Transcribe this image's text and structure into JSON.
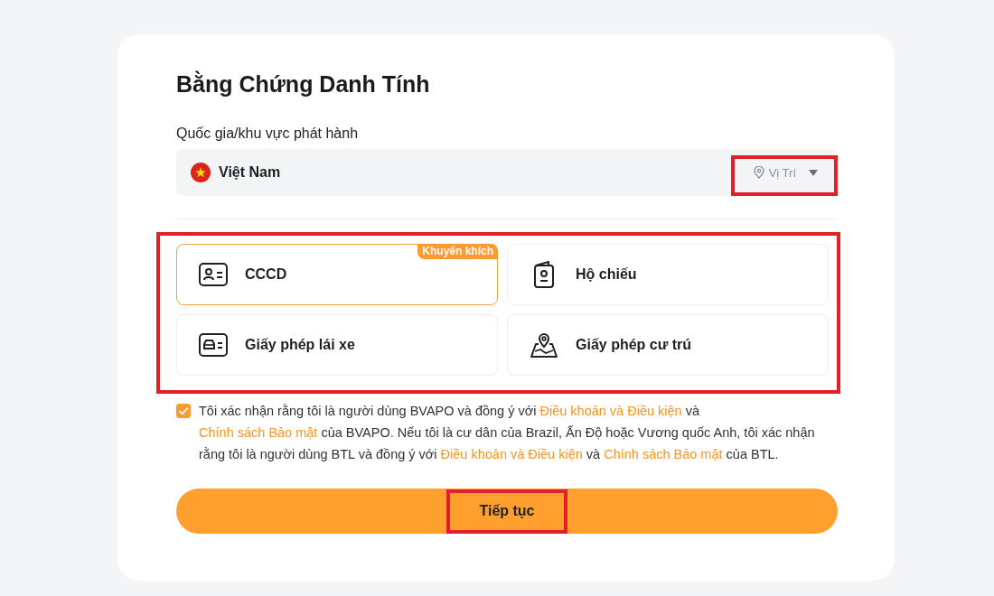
{
  "title": "Bằng Chứng Danh Tính",
  "issuing_country": {
    "label": "Quốc gia/khu vực phát hành",
    "value": "Việt Nam",
    "location_button": "Vị Trí",
    "highlighted": true
  },
  "document_types": {
    "highlighted": true,
    "options": [
      {
        "kind": "id-card",
        "label": "CCCD",
        "selected": true,
        "badge": "Khuyến khích"
      },
      {
        "kind": "passport",
        "label": "Hộ chiếu",
        "selected": false
      },
      {
        "kind": "driving-license",
        "label": "Giấy phép lái xe",
        "selected": false
      },
      {
        "kind": "residence-permit",
        "label": "Giấy phép cư trú",
        "selected": false
      }
    ]
  },
  "consent": {
    "checked": true,
    "parts": [
      {
        "kind": "text",
        "text": "Tôi xác nhận rằng tôi là người dùng BVAPO và đồng ý với "
      },
      {
        "kind": "link",
        "text": "Điều khoản và Điều kiện"
      },
      {
        "kind": "text",
        "text": " và "
      },
      {
        "kind": "link",
        "text": "Chính sách Bảo mật"
      },
      {
        "kind": "text",
        "text": " của BVAPO. Nếu tôi là cư dân của Brazil, Ấn Độ hoặc Vương quốc Anh, tôi xác nhận rằng tôi là người dùng BTL và đồng ý với "
      },
      {
        "kind": "link",
        "text": "Điều khoản và Điều kiện"
      },
      {
        "kind": "text",
        "text": " và "
      },
      {
        "kind": "link",
        "text": "Chính sách Bảo mật"
      },
      {
        "kind": "text",
        "text": " của BTL."
      }
    ]
  },
  "continue_button": {
    "label": "Tiếp tục",
    "highlighted": true
  }
}
